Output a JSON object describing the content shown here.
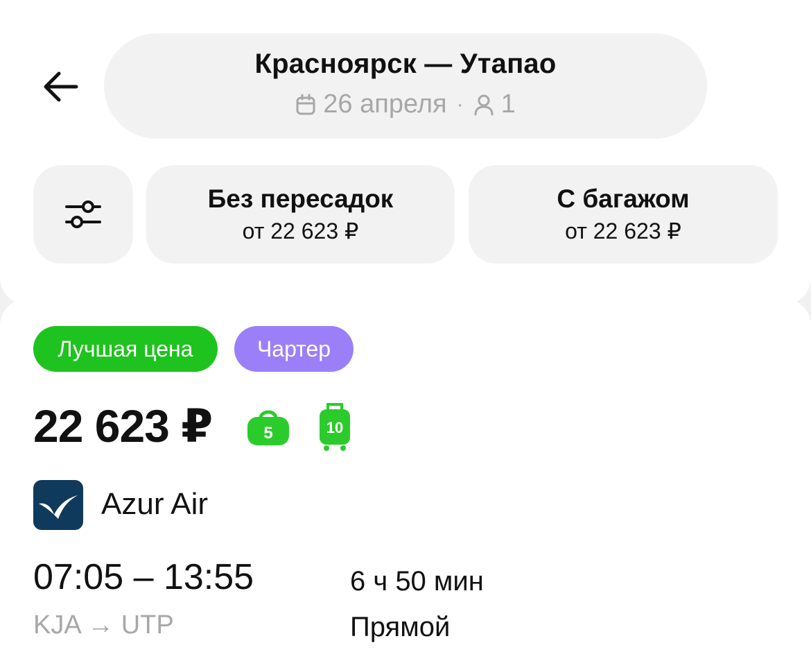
{
  "header": {
    "route_title": "Красноярск — Утапао",
    "date": "26 апреля",
    "separator": "·",
    "passengers": "1"
  },
  "filters": {
    "direct": {
      "title": "Без пересадок",
      "price": "от 22 623 ₽"
    },
    "baggage": {
      "title": "С багажом",
      "price": "от 22 623 ₽"
    }
  },
  "ticket": {
    "badges": [
      "Лучшая цена",
      "Чартер"
    ],
    "price": "22 623 ₽",
    "hand_baggage_kg": "5",
    "checked_baggage_kg": "10",
    "airline": "Azur Air",
    "times": "07:05 – 13:55",
    "route_codes": "KJA → UTP",
    "duration": "6 ч 50 мин",
    "transfers": "Прямой"
  },
  "colors": {
    "badge_best": "#1fc31f",
    "badge_charter": "#9b7ff8",
    "baggage_icon": "#2ccb2c",
    "airline_logo": "#103a5c",
    "secondary_text": "#a7a7a7"
  },
  "icons": [
    "back-arrow-icon",
    "calendar-icon",
    "person-icon",
    "filter-sliders-icon",
    "hand-baggage-icon",
    "suitcase-icon",
    "azur-air-logo"
  ]
}
